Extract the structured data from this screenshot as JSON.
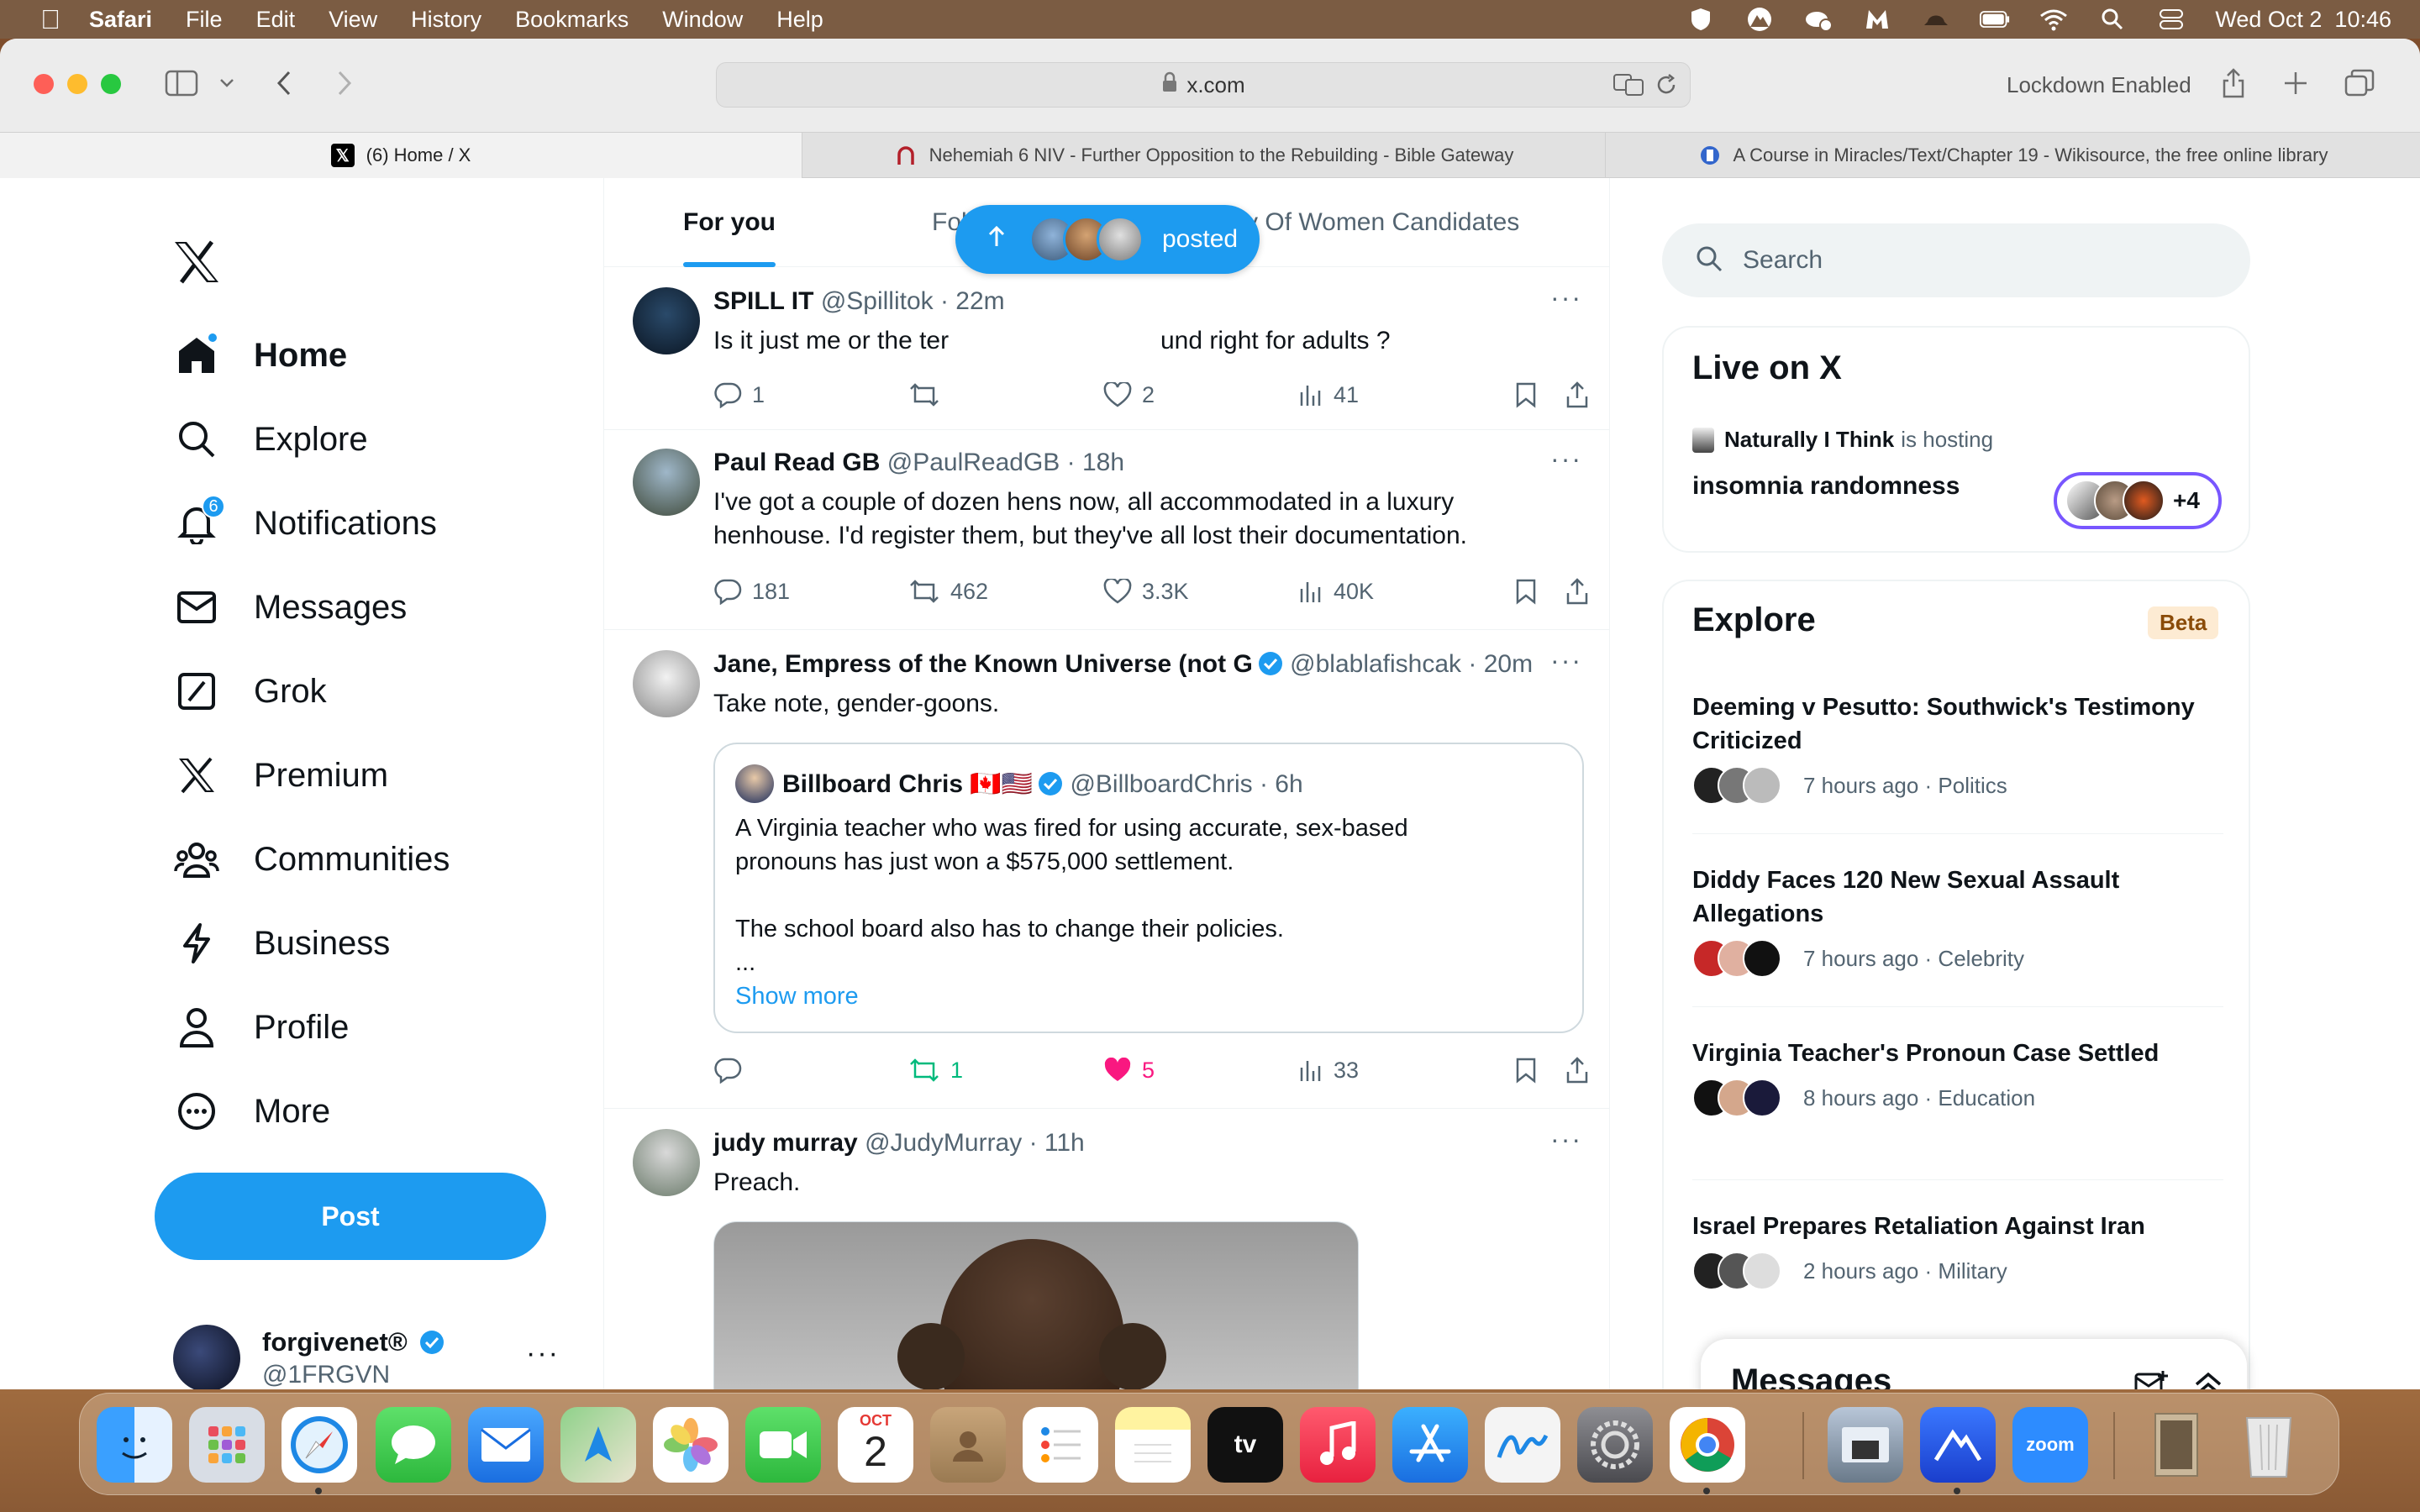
{
  "menubar": {
    "app": "Safari",
    "items": [
      "File",
      "Edit",
      "View",
      "History",
      "Bookmarks",
      "Window",
      "Help"
    ],
    "datetime": "Wed Oct 2  10:46"
  },
  "browser": {
    "url": "x.com",
    "lockdown": "Lockdown Enabled",
    "tabs": [
      {
        "title": "(6) Home / X"
      },
      {
        "title": "Nehemiah 6 NIV - Further Opposition to the Rebuilding - Bible Gateway"
      },
      {
        "title": "A Course in Miracles/Text/Chapter 19 - Wikisource, the free online library"
      }
    ]
  },
  "nav": {
    "items": [
      {
        "label": "Home",
        "icon": "home-icon"
      },
      {
        "label": "Explore",
        "icon": "search-icon"
      },
      {
        "label": "Notifications",
        "icon": "bell-icon",
        "badge": "6"
      },
      {
        "label": "Messages",
        "icon": "mail-icon"
      },
      {
        "label": "Grok",
        "icon": "grok-icon"
      },
      {
        "label": "Premium",
        "icon": "x-icon"
      },
      {
        "label": "Communities",
        "icon": "people-icon"
      },
      {
        "label": "Business",
        "icon": "lightning-icon"
      },
      {
        "label": "Profile",
        "icon": "person-icon"
      },
      {
        "label": "More",
        "icon": "more-circle-icon"
      }
    ],
    "post_label": "Post",
    "account": {
      "name": "forgivenet®",
      "handle": "@1FRGVN",
      "more": "···"
    }
  },
  "feed": {
    "tabs": [
      {
        "label": "For you"
      },
      {
        "label": "Following"
      },
      {
        "label": "Party Of Women Candidates"
      }
    ],
    "posted_pill": "posted",
    "tweets": [
      {
        "name": "SPILL IT",
        "handle": "@Spillitok",
        "time": "· 22m",
        "text_a": "Is it just me or the ter",
        "text_b": "und right for adults ?",
        "replies": "1",
        "retweets": "",
        "likes": "2",
        "views": "41"
      },
      {
        "name": "Paul Read GB",
        "handle": "@PaulReadGB",
        "time": "· 18h",
        "text": "I've got a couple of dozen hens now, all accommodated in a luxury henhouse. I'd register them, but they've all lost their documentation.",
        "replies": "181",
        "retweets": "462",
        "likes": "3.3K",
        "views": "40K"
      },
      {
        "name": "Jane, Empress of the Known Universe (not G",
        "handle": "@blablafishcak",
        "time": "· 20m",
        "text": "Take note, gender-goons.",
        "quote": {
          "name": "Billboard Chris",
          "flags": "🇨🇦🇺🇸",
          "handle": "@BillboardChris",
          "time": "· 6h",
          "text1": "A Virginia teacher who was fired for using accurate, sex-based pronouns has just won a $575,000 settlement.",
          "text2": "The school board also has to change their policies.",
          "ellipsis": "...",
          "show_more": "Show more"
        },
        "replies": "",
        "retweets": "1",
        "likes": "5",
        "views": "33"
      },
      {
        "name": "judy murray",
        "handle": "@JudyMurray",
        "time": "· 11h",
        "text": "Preach."
      }
    ]
  },
  "sidebar": {
    "search_placeholder": "Search",
    "live": {
      "title": "Live on X",
      "host": "Naturally I Think",
      "hosting": "is hosting",
      "space": "insomnia randomness",
      "extra": "+4"
    },
    "explore": {
      "title": "Explore",
      "beta": "Beta",
      "trends": [
        {
          "title": "Deeming v Pesutto: Southwick's Testimony Criticized",
          "meta": "7 hours ago · Politics"
        },
        {
          "title": "Diddy Faces 120 New Sexual Assault Allegations",
          "meta": "7 hours ago · Celebrity"
        },
        {
          "title": "Virginia Teacher's Pronoun Case Settled",
          "meta": "8 hours ago · Education"
        },
        {
          "title": "Israel Prepares Retaliation Against Iran",
          "meta": "2 hours ago · Military"
        }
      ]
    },
    "messages": "Messages"
  },
  "dock": {
    "calendar_month": "OCT",
    "calendar_day": "2",
    "zoom": "zoom",
    "tv": "tv"
  },
  "colors": {
    "accent": "#1d9bf0",
    "like": "#f91880",
    "retweet": "#00ba7c"
  }
}
